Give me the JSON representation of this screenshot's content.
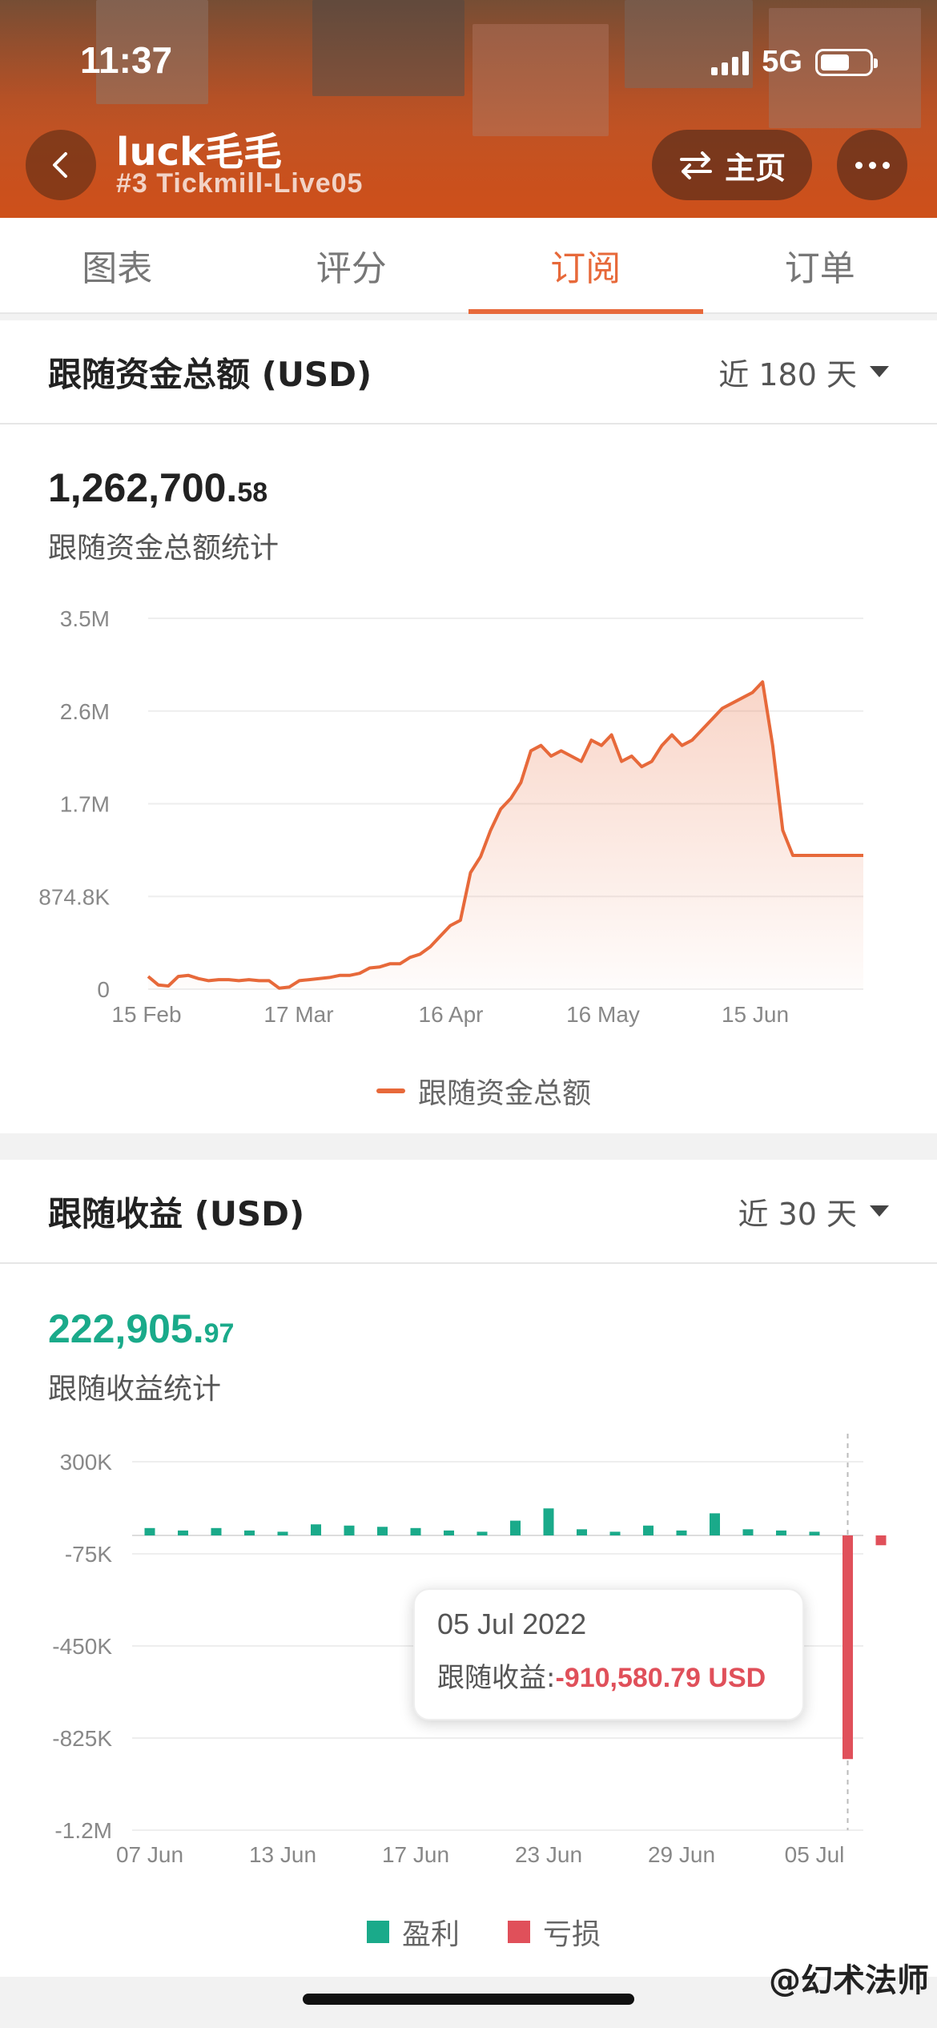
{
  "status_bar": {
    "time": "11:37",
    "network": "5G"
  },
  "header": {
    "title": "luck毛毛",
    "subtitle": "#3 Tickmill-Live05",
    "home_label": "主页"
  },
  "tabs": [
    {
      "label": "图表",
      "active": false
    },
    {
      "label": "评分",
      "active": false
    },
    {
      "label": "订阅",
      "active": true
    },
    {
      "label": "订单",
      "active": false
    }
  ],
  "colors": {
    "accent": "#e7693a",
    "profit": "#1aaa8a",
    "loss": "#e0505a"
  },
  "funds_card": {
    "title": "跟随资金总额 (USD)",
    "range": "近 180 天",
    "value_int": "1,262,700.",
    "value_dec": "58",
    "value_label": "跟随资金总额统计",
    "legend": "跟随资金总额"
  },
  "profit_card": {
    "title": "跟随收益 (USD)",
    "range": "近 30 天",
    "value_int": "222,905.",
    "value_dec": "97",
    "value_label": "跟随收益统计",
    "legend_profit": "盈利",
    "legend_loss": "亏损",
    "tooltip": {
      "date": "05 Jul 2022",
      "label": "跟随收益:",
      "value": "-910,580.79 USD"
    }
  },
  "watermark": "@幻术法师",
  "chart_data": [
    {
      "type": "area",
      "y_ticks": [
        "3.5M",
        "2.6M",
        "1.7M",
        "874.8K",
        "0"
      ],
      "ylim": [
        0,
        3500000
      ],
      "x_ticks": [
        "15 Feb",
        "17 Mar",
        "16 Apr",
        "16 May",
        "15 Jun"
      ],
      "series": [
        {
          "name": "跟随资金总额",
          "x_days": [
            0,
            2,
            4,
            6,
            8,
            10,
            12,
            14,
            16,
            18,
            20,
            22,
            24,
            26,
            28,
            30,
            32,
            34,
            36,
            38,
            40,
            42,
            44,
            46,
            48,
            50,
            52,
            54,
            56,
            58,
            60,
            62,
            64,
            66,
            68,
            70,
            72,
            74,
            76,
            78,
            80,
            82,
            84,
            86,
            88,
            90,
            92,
            94,
            96,
            98,
            100,
            102,
            104,
            106,
            108,
            110,
            112,
            114,
            116,
            118,
            120,
            122,
            124,
            126,
            128,
            130,
            132,
            134,
            136,
            138,
            140,
            142
          ],
          "values": [
            120000,
            40000,
            30000,
            120000,
            130000,
            100000,
            80000,
            90000,
            90000,
            80000,
            90000,
            80000,
            80000,
            10000,
            20000,
            80000,
            90000,
            100000,
            110000,
            130000,
            130000,
            150000,
            200000,
            210000,
            240000,
            240000,
            300000,
            330000,
            400000,
            500000,
            600000,
            650000,
            1100000,
            1250000,
            1500000,
            1700000,
            1800000,
            1950000,
            2250000,
            2300000,
            2200000,
            2250000,
            2200000,
            2150000,
            2350000,
            2300000,
            2400000,
            2150000,
            2200000,
            2100000,
            2150000,
            2300000,
            2400000,
            2300000,
            2350000,
            2450000,
            2550000,
            2650000,
            2700000,
            2750000,
            2800000,
            2900000,
            2300000,
            1500000,
            1262700,
            1262700,
            1262700,
            1262700,
            1262700,
            1262700,
            1262700,
            1262700
          ]
        }
      ]
    },
    {
      "type": "bar",
      "y_ticks": [
        "300K",
        "-75K",
        "-450K",
        "-825K",
        "-1.2M"
      ],
      "ylim": [
        -1200000,
        300000
      ],
      "x_ticks": [
        "07 Jun",
        "13 Jun",
        "17 Jun",
        "23 Jun",
        "29 Jun",
        "05 Jul"
      ],
      "series": [
        {
          "name": "盈利",
          "values": [
            30000,
            20000,
            30000,
            20000,
            15000,
            45000,
            40000,
            35000,
            30000,
            20000,
            15000,
            60000,
            110000,
            25000,
            15000,
            40000,
            20000,
            90000,
            25000,
            20000,
            15000,
            0,
            0
          ]
        },
        {
          "name": "亏损",
          "values": [
            0,
            0,
            0,
            0,
            0,
            0,
            0,
            0,
            0,
            0,
            0,
            0,
            0,
            0,
            0,
            0,
            0,
            0,
            0,
            0,
            0,
            -910580.79,
            -40000
          ]
        }
      ]
    }
  ]
}
